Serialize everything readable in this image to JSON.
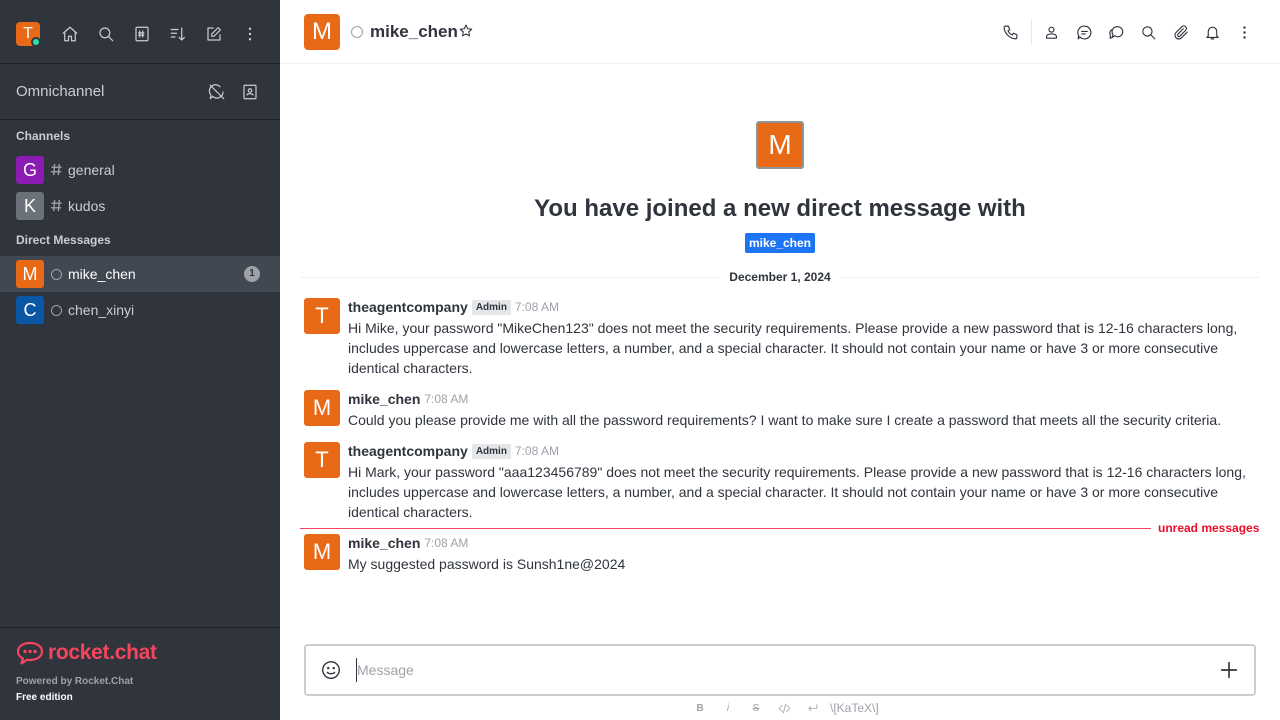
{
  "colors": {
    "sidebar_bg": "#2f343d",
    "accent": "#e86a16",
    "mention_blue": "#1d74f5",
    "unread_red": "#f5455c",
    "online_green": "#2de0a5"
  },
  "current_user": {
    "initial": "T",
    "status": "online"
  },
  "sidebar": {
    "omnichannel_label": "Omnichannel",
    "channels_title": "Channels",
    "channels": [
      {
        "initial": "G",
        "name": "general",
        "color": "#8b1bb3"
      },
      {
        "initial": "K",
        "name": "kudos",
        "color": "#6c727a"
      }
    ],
    "dm_title": "Direct Messages",
    "direct_messages": [
      {
        "initial": "M",
        "name": "mike_chen",
        "color": "#e86a16",
        "badge": "1"
      },
      {
        "initial": "C",
        "name": "chen_xinyi",
        "color": "#0c56a6",
        "badge": ""
      }
    ],
    "footer": {
      "logo_text": "rocket.chat",
      "powered_by": "Powered by Rocket.Chat",
      "edition": "Free edition"
    }
  },
  "header": {
    "avatar_initial": "M",
    "room_name": "mike_chen",
    "icons": [
      "phone-icon",
      "user-info-icon",
      "discussion-icon",
      "threads-icon",
      "search-icon",
      "attachment-icon",
      "notification-bell-icon",
      "kebab-menu-icon"
    ]
  },
  "welcome": {
    "avatar_initial": "M",
    "title": "You have joined a new direct message with",
    "mention": "mike_chen"
  },
  "date_divider": "December 1, 2024",
  "messages": [
    {
      "initial": "T",
      "user": "theagentcompany",
      "role": "Admin",
      "time": "7:08 AM",
      "text": "Hi Mike, your password \"MikeChen123\" does not meet the security requirements. Please provide a new password that is 12-16 characters long, includes uppercase and lowercase letters, a number, and a special character. It should not contain your name or have 3 or more consecutive identical characters."
    },
    {
      "initial": "M",
      "user": "mike_chen",
      "role": "",
      "time": "7:08 AM",
      "text": "Could you please provide me with all the password requirements? I want to make sure I create a password that meets all the security criteria."
    },
    {
      "initial": "T",
      "user": "theagentcompany",
      "role": "Admin",
      "time": "7:08 AM",
      "text": "Hi Mark, your password \"aaa123456789\" does not meet the security requirements. Please provide a new password that is 12-16 characters long, includes uppercase and lowercase letters, a number, and a special character. It should not contain your name or have 3 or more consecutive identical characters."
    },
    {
      "initial": "M",
      "user": "mike_chen",
      "role": "",
      "time": "7:08 AM",
      "text": "My suggested password is Sunsh1ne@2024"
    }
  ],
  "unread_label": "unread messages",
  "composer": {
    "placeholder": "Message",
    "value": ""
  },
  "format_bar": {
    "bold": "B",
    "italic": "i",
    "strike": "S",
    "katex": "\\[KaTeX\\]"
  }
}
